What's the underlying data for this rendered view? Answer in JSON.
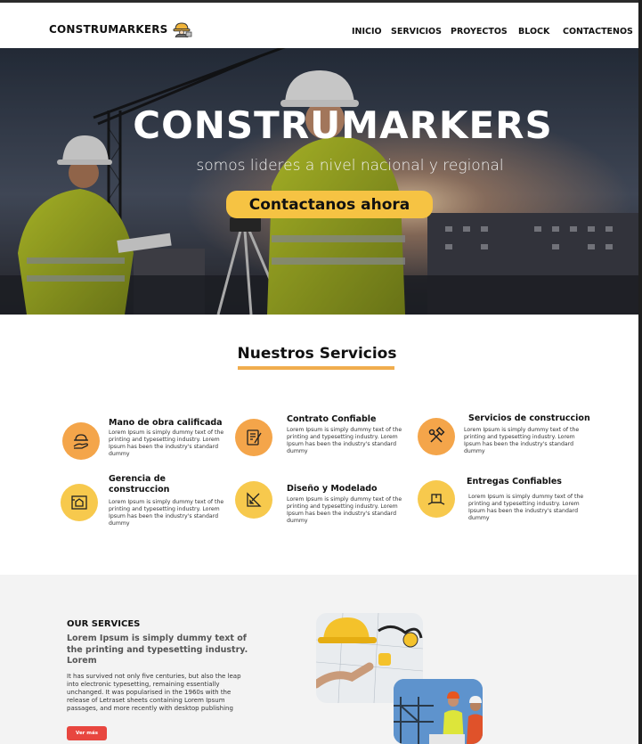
{
  "header": {
    "brand": "CONSTRUMARKERS",
    "brand_icon": "worker-with-hardhat-icon",
    "nav": [
      "INICIO",
      "SERVICIOS",
      "PROYECTOS",
      "BLOCK",
      "CONTACTENOS"
    ]
  },
  "hero": {
    "title": "CONSTRUMARKERS",
    "subtitle": "somos lideres a  nivel nacional y regional",
    "cta": "Contactanos ahora"
  },
  "services": {
    "heading": "Nuestros Servicios",
    "items": [
      {
        "title": "Mano de obra calificada",
        "desc": "Lorem Ipsum is simply dummy text of the printing and typesetting industry. Lorem Ipsum has been the industry's standard dummy",
        "icon": "worker-hand-icon"
      },
      {
        "title": "Contrato Confiable",
        "desc": "Lorem Ipsum is simply dummy text of the printing and typesetting industry. Lorem Ipsum has been the industry's standard dummy",
        "icon": "contract-pen-icon"
      },
      {
        "title": "Servicios de construccion",
        "desc": "Lorem Ipsum is simply dummy text of the printing and typesetting industry. Lorem Ipsum has been the industry's standard dummy",
        "icon": "hammer-wrench-icon"
      },
      {
        "title": "Gerencia de construccion",
        "desc": "Lorem Ipsum is simply dummy text of the printing and typesetting industry. Lorem Ipsum has been the industry's standard dummy",
        "icon": "building-blueprint-icon"
      },
      {
        "title": "Diseño y Modelado",
        "desc": "Lorem Ipsum is simply dummy text of the printing and typesetting industry. Lorem Ipsum has been the industry's standard dummy",
        "icon": "ruler-pencil-icon"
      },
      {
        "title": "Entregas Confiables",
        "desc": "Lorem Ipsum is simply dummy text of the printing and typesetting industry. Lorem Ipsum has been the industry's standard dummy",
        "icon": "delivery-box-icon"
      }
    ]
  },
  "our_services": {
    "title": "OUR SERVICES",
    "lead": "Lorem Ipsum is simply dummy text of the printing and typesetting industry. Lorem",
    "body": "It has survived not only five centuries, but also the leap into electronic typesetting, remaining essentially unchanged. It was popularised in the 1960s with the release of Letraset sheets containing Lorem Ipsum passages, and more recently with desktop publishing",
    "button": "Ver más"
  },
  "colors": {
    "accent_yellow": "#f6c343",
    "accent_orange": "#f0ad4e",
    "circle_orange": "#f4a54a",
    "circle_yellow": "#f7c94d",
    "button_red": "#e8463f",
    "lower_bg": "#f3f3f3"
  }
}
